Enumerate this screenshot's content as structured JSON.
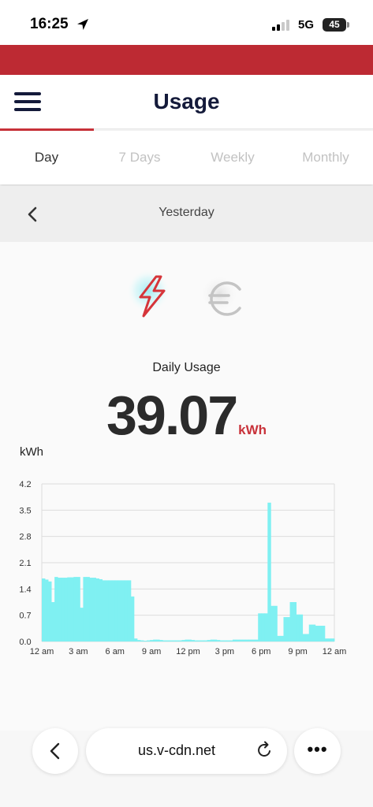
{
  "status_bar": {
    "time": "16:25",
    "network": "5G",
    "battery": "45"
  },
  "header": {
    "title": "Usage",
    "menu_icon": "hamburger-icon"
  },
  "tabs": [
    {
      "label": "Day",
      "active": true
    },
    {
      "label": "7 Days",
      "active": false
    },
    {
      "label": "Weekly",
      "active": false
    },
    {
      "label": "Monthly",
      "active": false
    }
  ],
  "date_nav": {
    "label": "Yesterday",
    "back_icon": "chevron-left-icon"
  },
  "mode_toggle": {
    "kwh_icon": "lightning-icon",
    "euro_icon": "euro-icon",
    "active": "kwh"
  },
  "summary": {
    "label": "Daily Usage",
    "value": "39.07",
    "unit": "kWh"
  },
  "chart_data": {
    "type": "bar",
    "ylabel": "kWh",
    "ylim": [
      0,
      4.2
    ],
    "yticks": [
      "0.0",
      "0.7",
      "1.4",
      "2.1",
      "2.8",
      "3.5",
      "4.2"
    ],
    "xticks": [
      "12 am",
      "3 am",
      "6 am",
      "9 am",
      "12 pm",
      "3 pm",
      "6 pm",
      "9 pm",
      "12 am"
    ],
    "grid": true,
    "series": [
      {
        "values": [
          1.68,
          1.65,
          1.6,
          1.05,
          1.72,
          1.7,
          1.7,
          1.7,
          1.71,
          1.71,
          1.72,
          1.72,
          0.9,
          1.72,
          1.72,
          1.7,
          1.7,
          1.68,
          1.66,
          1.63,
          1.63,
          1.63,
          1.63,
          1.63,
          1.63,
          1.63,
          1.63,
          1.63,
          1.2,
          0.08,
          0.04,
          0.03,
          0.02,
          0.03,
          0.04,
          0.05,
          0.05,
          0.04,
          0.03,
          0.03,
          0.03,
          0.03,
          0.03,
          0.03,
          0.04,
          0.05,
          0.05,
          0.04,
          0.03,
          0.03,
          0.03,
          0.03,
          0.04,
          0.05,
          0.05,
          0.04,
          0.03,
          0.03,
          0.03,
          0.03,
          0.05,
          0.05,
          0.05,
          0.05,
          0.05,
          0.05,
          0.05,
          0.05,
          0.75,
          0.75,
          0.75,
          3.7,
          0.95,
          0.95,
          0.15,
          0.15,
          0.65,
          0.65,
          1.05,
          1.05,
          0.72,
          0.72,
          0.2,
          0.2,
          0.45,
          0.45,
          0.42,
          0.42,
          0.42,
          0.08,
          0.08,
          0.08
        ],
        "color": "#7ff0f2"
      }
    ]
  },
  "browser": {
    "url": "us.v-cdn.net",
    "back_icon": "chevron-left-icon",
    "reload_icon": "reload-icon",
    "more_icon": "more-icon",
    "more_label": "•••"
  },
  "colors": {
    "brand_red": "#bd2a33",
    "accent_red": "#c8323a",
    "navy": "#141a3a",
    "bar_fill": "#7ff0f2"
  }
}
